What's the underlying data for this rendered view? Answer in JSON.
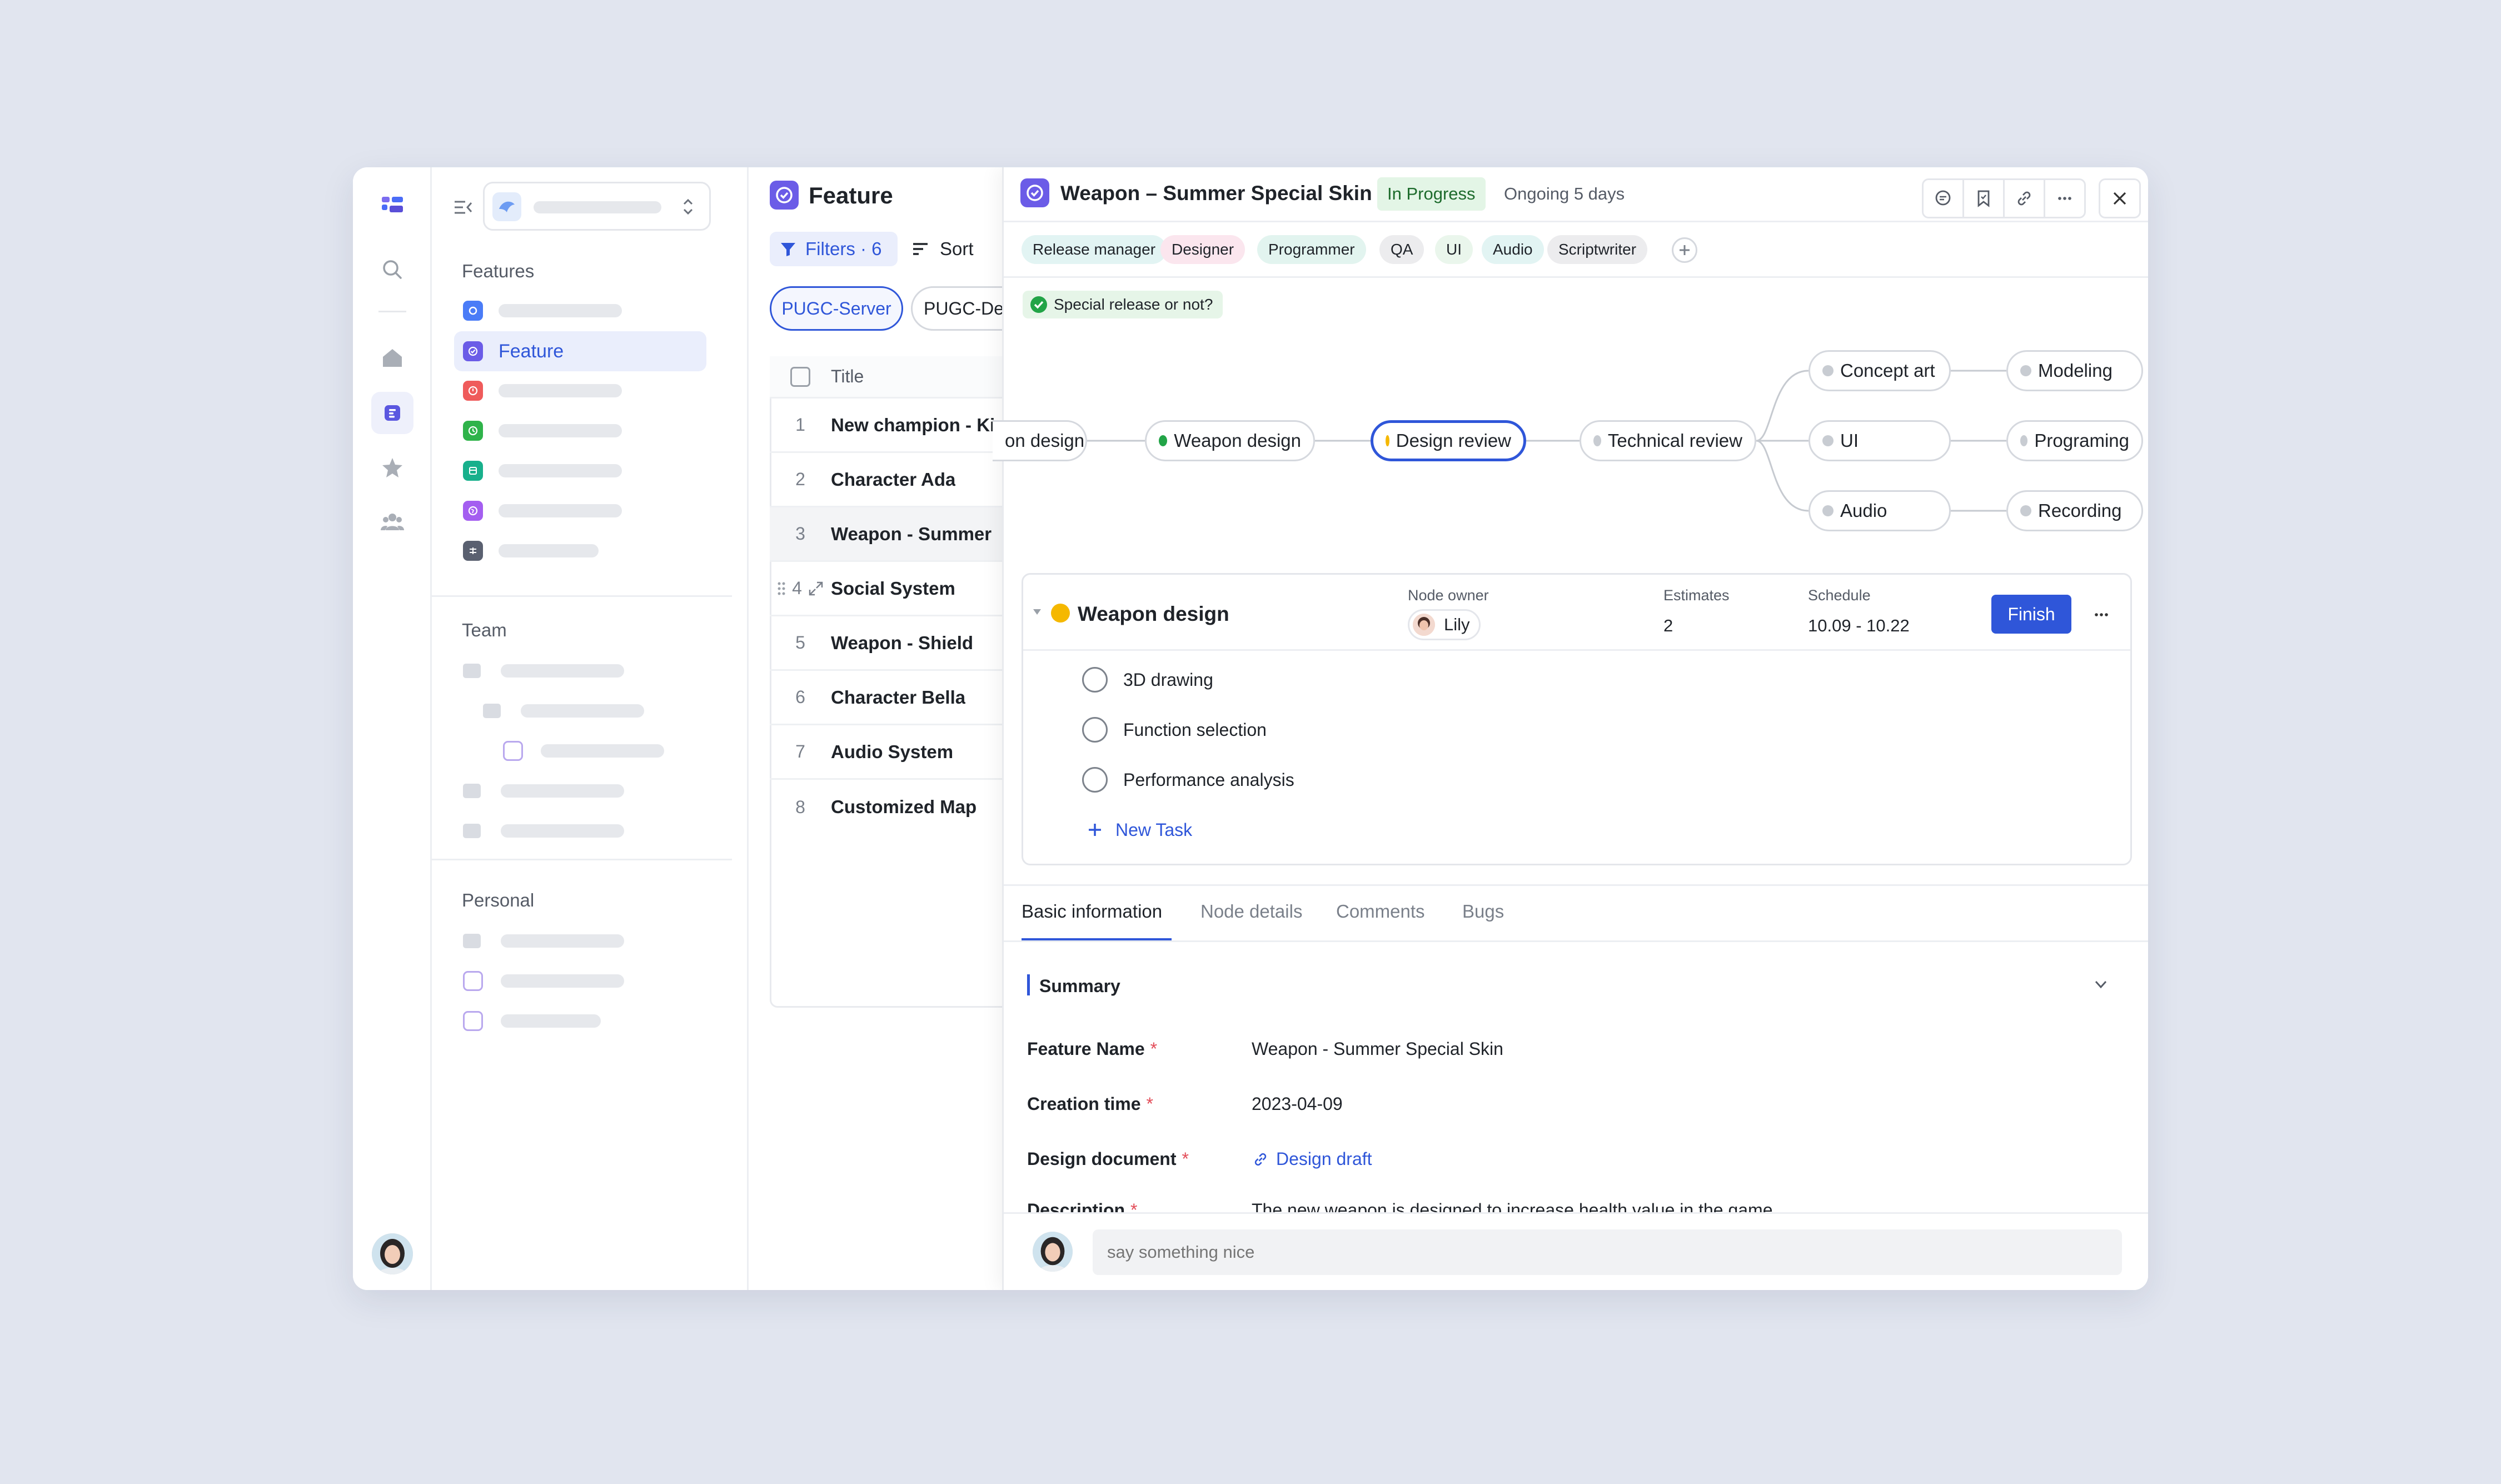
{
  "sidebar": {
    "sections": {
      "features": "Features",
      "team": "Team",
      "personal": "Personal"
    },
    "active_item": "Feature"
  },
  "list": {
    "title": "Feature",
    "filters_label": "Filters · 6",
    "sort_label": "Sort",
    "chips": [
      "PUGC-Server",
      "PUGC-De"
    ],
    "column_title": "Title",
    "rows": [
      {
        "num": "1",
        "title": "New champion - Ki"
      },
      {
        "num": "2",
        "title": "Character Ada"
      },
      {
        "num": "3",
        "title": "Weapon - Summer"
      },
      {
        "num": "4",
        "title": "Social System"
      },
      {
        "num": "5",
        "title": "Weapon - Shield"
      },
      {
        "num": "6",
        "title": "Character Bella"
      },
      {
        "num": "7",
        "title": "Audio System"
      },
      {
        "num": "8",
        "title": "Customized Map"
      }
    ]
  },
  "detail": {
    "title": "Weapon – Summer Special Skin",
    "status": "In Progress",
    "status_note": "Ongoing 5 days",
    "tags": [
      "Release manager",
      "Designer",
      "Programmer",
      "QA",
      "UI",
      "Audio",
      "Scriptwriter"
    ],
    "special_flag": "Special release or not?",
    "workflow": {
      "nodes": [
        "on design",
        "Weapon design",
        "Design review",
        "Technical review",
        "Concept art",
        "UI",
        "Audio",
        "Modeling",
        "Programing",
        "Recording"
      ]
    },
    "node_card": {
      "name": "Weapon design",
      "owner_label": "Node owner",
      "owner": "Lily",
      "estimates_label": "Estimates",
      "estimates": "2",
      "schedule_label": "Schedule",
      "schedule": "10.09 - 10.22",
      "finish_label": "Finish",
      "tasks": [
        "3D drawing",
        "Function selection",
        "Performance analysis"
      ],
      "new_task_label": "New Task"
    },
    "tabs": [
      "Basic information",
      "Node details",
      "Comments",
      "Bugs"
    ],
    "summary_label": "Summary",
    "fields": [
      {
        "label": "Feature Name",
        "value": "Weapon - Summer Special Skin"
      },
      {
        "label": "Creation time",
        "value": "2023-04-09"
      },
      {
        "label": "Design document",
        "value": "Design draft"
      },
      {
        "label": "Description",
        "value": "The new weapon is designed to increase health value in the game"
      }
    ],
    "comment_placeholder": "say something nice"
  },
  "colors": {
    "accent": "#2f56d9",
    "brand": "#6b5ce7",
    "background": "#e1e5ef"
  }
}
